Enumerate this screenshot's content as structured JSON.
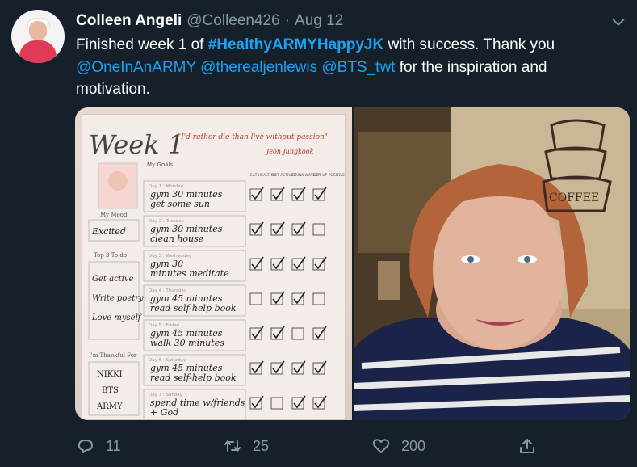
{
  "tweet": {
    "author_name": "Colleen Angeli",
    "handle": "@Colleen426",
    "separator": "·",
    "date": "Aug 12",
    "text_part1": "Finished week 1 of ",
    "hashtag": "#HealthyARMYHappyJK",
    "text_part2": " with success. Thank you",
    "mention1": "@OneInAnARMY",
    "mention2": "@therealjenlewis",
    "mention3": "@BTS_twt",
    "text_part3": " for the inspiration and motivation."
  },
  "media": {
    "left_image_icon": "weekly-journal-photo",
    "right_image_icon": "selfie-photo",
    "journal": {
      "week": "Week 1",
      "quote": "\"I'd rather die than live without passion\"",
      "quote_author": "Jeon Jungkook",
      "goals_label": "My Goals",
      "mood_label": "My Mood",
      "mood_value": "Excited",
      "top3_label": "Top 3 To-do",
      "top3_items": [
        "Get active",
        "Write poetry",
        "Love myself"
      ],
      "thankful_label": "I'm Thankful For",
      "thankful_items": [
        "NIKKI",
        "BTS",
        "ARMY"
      ],
      "check_headers": [
        "EAT HEALTHY?",
        "GOT ACTIVE?",
        "DRINK WATER?",
        "GOT UP POSITIVE?"
      ],
      "days": [
        {
          "label": "Day 1 : Monday",
          "text": "gym 30 minutes get some sun",
          "checks": [
            true,
            true,
            true,
            true
          ]
        },
        {
          "label": "Day 2 : Tuesday",
          "text": "gym 30 minutes clean house",
          "checks": [
            true,
            true,
            true,
            false
          ]
        },
        {
          "label": "Day 3 : Wednesday",
          "text": "gym 30 minutes meditate",
          "checks": [
            true,
            true,
            true,
            true
          ]
        },
        {
          "label": "Day 4 : Thursday",
          "text": "gym 45 minutes read self-help book",
          "checks": [
            false,
            true,
            true,
            false
          ]
        },
        {
          "label": "Day 5 : Friday",
          "text": "gym 45 minutes walk 30 minutes",
          "checks": [
            true,
            true,
            false,
            true
          ]
        },
        {
          "label": "Day 6 : Saturday",
          "text": "gym 45 minutes read self-help book",
          "checks": [
            true,
            true,
            true,
            true
          ]
        },
        {
          "label": "Day 7 : Sunday",
          "text": "spend time w/friends + God",
          "checks": [
            true,
            false,
            true,
            true
          ]
        }
      ],
      "wall_sign": "COFFEE"
    }
  },
  "actions": {
    "reply_icon": "reply-icon",
    "reply_count": "11",
    "retweet_icon": "retweet-icon",
    "retweet_count": "25",
    "like_icon": "heart-icon",
    "like_count": "200",
    "share_icon": "share-icon"
  },
  "colors": {
    "background": "#15202b",
    "text": "#ffffff",
    "muted": "#8899a6",
    "link": "#1da1f2"
  }
}
